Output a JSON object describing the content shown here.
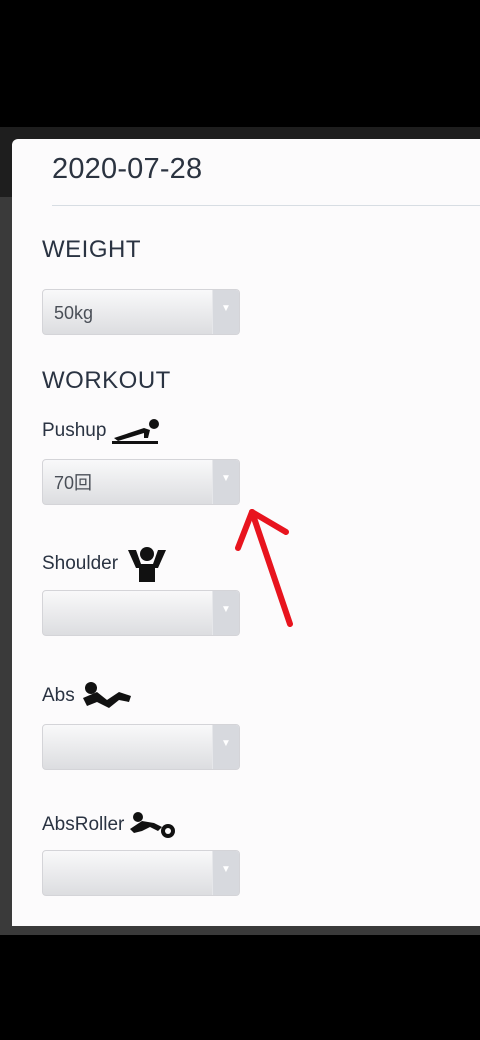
{
  "date": "2020-07-28",
  "weight": {
    "title": "WEIGHT",
    "value": "50kg"
  },
  "workout": {
    "title": "WORKOUT",
    "fields": [
      {
        "label": "Pushup",
        "value": "70回",
        "icon": "pushup-icon"
      },
      {
        "label": "Shoulder",
        "value": "",
        "icon": "shoulder-icon"
      },
      {
        "label": "Abs",
        "value": "",
        "icon": "abs-icon"
      },
      {
        "label": "AbsRoller",
        "value": "",
        "icon": "absroller-icon"
      }
    ]
  },
  "colors": {
    "annotation_arrow": "#e8141e",
    "text": "#2a3342"
  }
}
